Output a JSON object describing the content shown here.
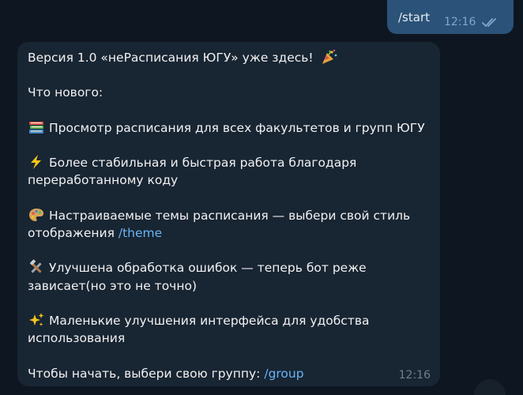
{
  "outgoing": {
    "text": "/start",
    "time": "12:16",
    "status_icon": "double-check-icon"
  },
  "incoming": {
    "time": "12:16",
    "title": "Версия 1.0 «неРасписания ЮГУ» уже здесь!",
    "whats_new": "Что нового:",
    "item1": "Просмотр расписания для всех факультетов и групп ЮГУ",
    "item2_l1": "Более стабильная и быстрая работа благодаря",
    "item2_l2": "переработанному коду",
    "item3_l1": "Настраиваемые темы расписания — выбери свой стиль",
    "item3_l2": "отображения ",
    "item3_link": "/theme",
    "item4_l1": "Улучшена обработка ошибок — теперь бот реже",
    "item4_l2": "зависает(но это не точно)",
    "item5_l1": "Маленькие улучшения интерфейса для удобства",
    "item5_l2": "использования",
    "cta": "Чтобы начать, выбери свою группу: ",
    "cta_link": "/group",
    "icons": [
      "party-popper-icon",
      "books-icon",
      "lightning-icon",
      "palette-icon",
      "tools-icon",
      "sparkles-icon"
    ]
  }
}
